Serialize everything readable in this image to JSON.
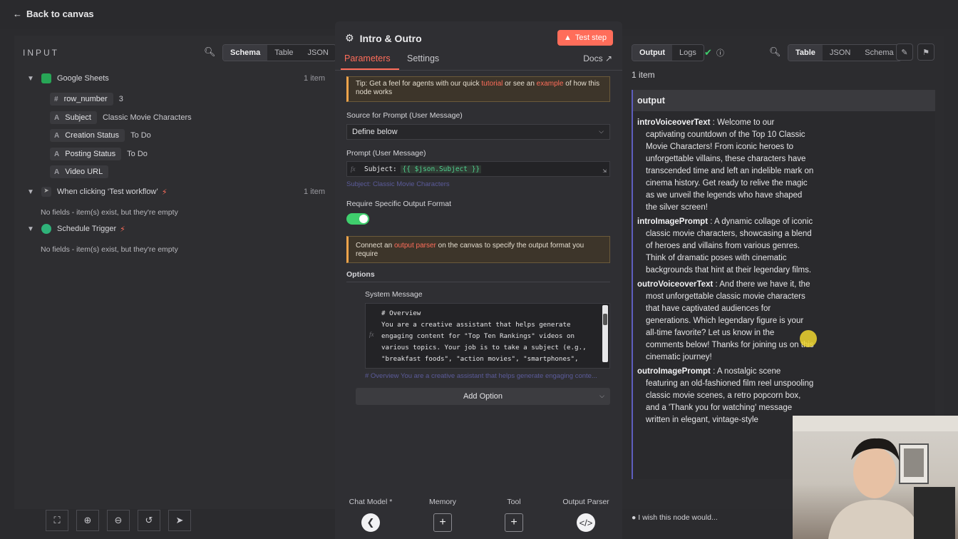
{
  "topbar": {
    "back_label": "Back to canvas"
  },
  "input": {
    "title": "INPUT",
    "view_tabs": [
      "Schema",
      "Table",
      "JSON"
    ],
    "nodes": [
      {
        "name": "Google Sheets",
        "count": "1 item",
        "fields": [
          {
            "type": "#",
            "name": "row_number",
            "value": "3"
          },
          {
            "type": "A",
            "name": "Subject",
            "value": "Classic Movie Characters"
          },
          {
            "type": "A",
            "name": "Creation Status",
            "value": "To Do"
          },
          {
            "type": "A",
            "name": "Posting Status",
            "value": "To Do"
          },
          {
            "type": "A",
            "name": "Video URL",
            "value": ""
          }
        ]
      },
      {
        "name": "When clicking ‘Test workflow’",
        "count": "1 item",
        "empty": "No fields - item(s) exist, but they're empty"
      },
      {
        "name": "Schedule Trigger",
        "count": "",
        "empty": "No fields - item(s) exist, but they're empty"
      }
    ]
  },
  "node": {
    "title": "Intro & Outro",
    "test_label": "Test step",
    "tabs": {
      "parameters": "Parameters",
      "settings": "Settings",
      "docs": "Docs"
    },
    "tip": {
      "pre": "Tip: Get a feel for agents with our quick ",
      "link1": "tutorial",
      "mid": " or see an ",
      "link2": "example",
      "post": " of how this node works"
    },
    "source_label": "Source for Prompt (User Message)",
    "source_value": "Define below",
    "prompt_label": "Prompt (User Message)",
    "prompt_prefix": "Subject: ",
    "prompt_expr": "{{ $json.Subject }}",
    "prompt_preview": "Subject: Classic Movie Characters",
    "require_label": "Require Specific Output Format",
    "connect": {
      "pre": "Connect an ",
      "link": "output parser",
      "post": " on the canvas to specify the output format you require"
    },
    "options_label": "Options",
    "system_label": "System Message",
    "system_text": "# Overview\nYou are a creative assistant that helps generate engaging content for \"Top Ten Rankings\" videos on various topics. Your job is to take a subject (e.g., \"breakfast foods\", \"action movies\", \"smartphones\", etc.) and create two parts of the script: an intro and an outro. Each part includes a",
    "system_preview": "# Overview You are a creative assistant that helps generate engaging conte...",
    "add_option": "Add Option",
    "connectors": [
      {
        "label": "Chat Model *"
      },
      {
        "label": "Memory"
      },
      {
        "label": "Tool"
      },
      {
        "label": "Output Parser"
      }
    ]
  },
  "output": {
    "tabs": [
      "Output",
      "Logs"
    ],
    "view_tabs": [
      "Table",
      "JSON",
      "Schema"
    ],
    "count": "1 item",
    "header": "output",
    "entries": [
      {
        "key": "introVoiceoverText",
        "value": "Welcome to our captivating countdown of the Top 10 Classic Movie Characters! From iconic heroes to unforgettable villains, these characters have transcended time and left an indelible mark on cinema history. Get ready to relive the magic as we unveil the legends who have shaped the silver screen!"
      },
      {
        "key": "introImagePrompt",
        "value": "A dynamic collage of iconic classic movie characters, showcasing a blend of heroes and villains from various genres. Think of dramatic poses with cinematic backgrounds that hint at their legendary films."
      },
      {
        "key": "outroVoiceoverText",
        "value": "And there we have it, the most unforgettable classic movie characters that have captivated audiences for generations. Which legendary figure is your all-time favorite? Let us know in the comments below! Thanks for joining us on this cinematic journey!"
      },
      {
        "key": "outroImagePrompt",
        "value": "A nostalgic scene featuring an old-fashioned film reel unspooling classic movie scenes, a retro popcorn box, and a 'Thank you for watching' message written in elegant, vintage-style"
      }
    ]
  },
  "feedback": "I wish this node would...",
  "colors": {
    "accent": "#ff6d5a",
    "success": "#3fcf6d",
    "parser_border": "#5e5ebd"
  }
}
